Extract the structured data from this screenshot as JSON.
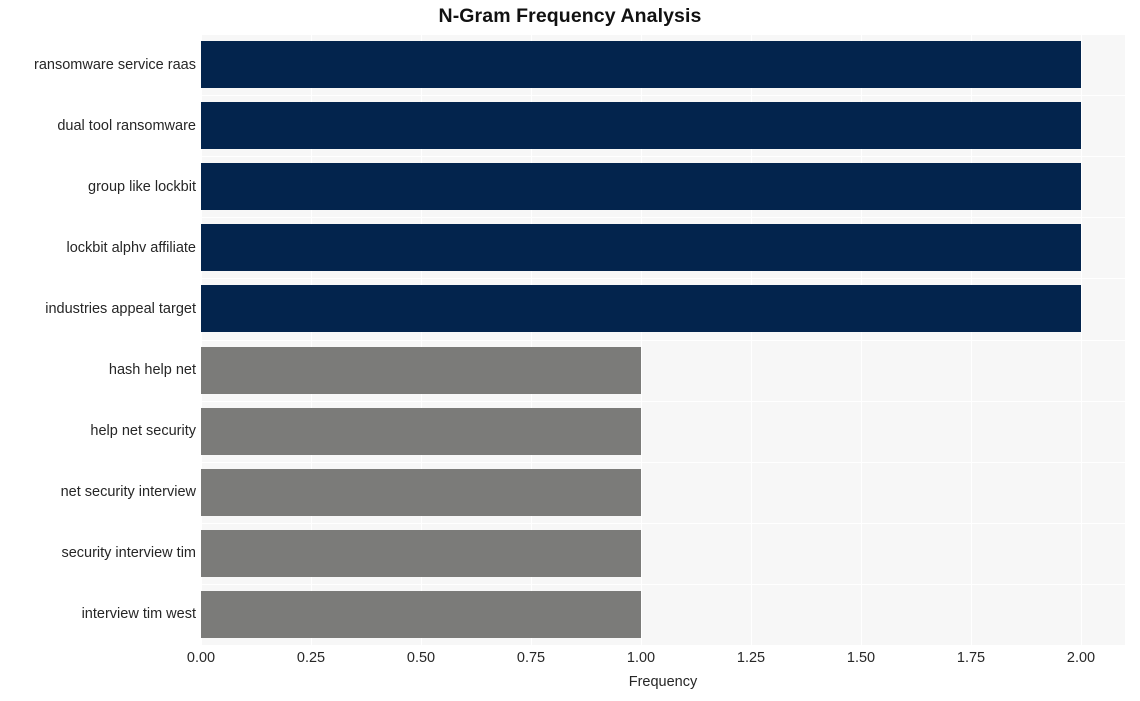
{
  "chart_data": {
    "type": "bar",
    "orientation": "horizontal",
    "title": "N-Gram Frequency Analysis",
    "xlabel": "Frequency",
    "ylabel": "",
    "categories": [
      "ransomware service raas",
      "dual tool ransomware",
      "group like lockbit",
      "lockbit alphv affiliate",
      "industries appeal target",
      "hash help net",
      "help net security",
      "net security interview",
      "security interview tim",
      "interview tim west"
    ],
    "values": [
      2,
      2,
      2,
      2,
      2,
      1,
      1,
      1,
      1,
      1
    ],
    "bar_colors": [
      "#03244d",
      "#03244d",
      "#03244d",
      "#03244d",
      "#03244d",
      "#7b7b79",
      "#7b7b79",
      "#7b7b79",
      "#7b7b79",
      "#7b7b79"
    ],
    "xlim": [
      0.0,
      2.1
    ],
    "xticks": [
      0.0,
      0.25,
      0.5,
      0.75,
      1.0,
      1.25,
      1.5,
      1.75,
      2.0
    ],
    "xtick_labels": [
      "0.00",
      "0.25",
      "0.50",
      "0.75",
      "1.00",
      "1.25",
      "1.50",
      "1.75",
      "2.00"
    ],
    "grid": true,
    "grid_color": "#ffffff",
    "plot_background": "#f7f7f7",
    "figure_background": "#ffffff",
    "legend": null
  }
}
